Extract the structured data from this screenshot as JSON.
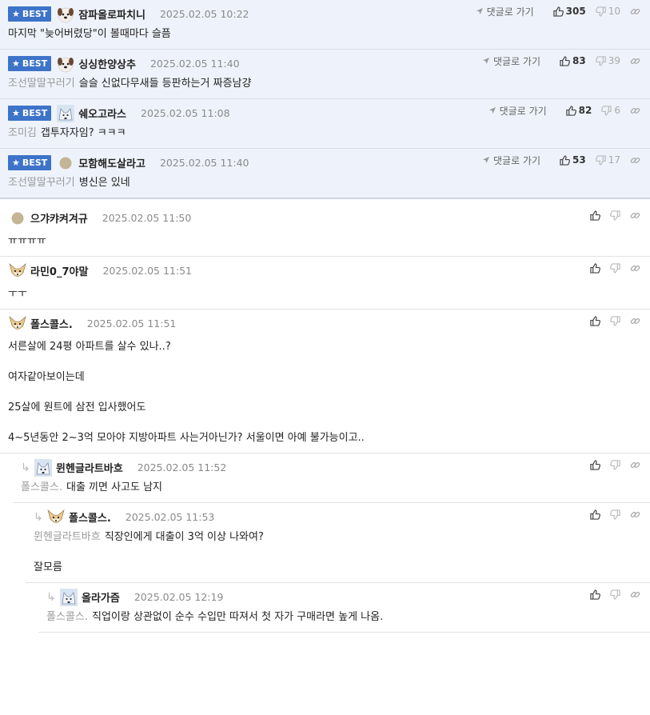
{
  "ui": {
    "best_label": "BEST",
    "goto_label": "댓글로 가기"
  },
  "best_comments": [
    {
      "nick": "잠파올로파치니",
      "avatar": "dog-avatar",
      "date": "2025.02.05 10:22",
      "likes": "305",
      "dislikes": "10",
      "mention": "",
      "lines": [
        "마지막 \"늦어버렸당\"이 볼때마다 슬픔"
      ]
    },
    {
      "nick": "싱싱한양상추",
      "avatar": "dog-avatar",
      "date": "2025.02.05 11:40",
      "likes": "83",
      "dislikes": "39",
      "mention": "조선딸딸꾸러기",
      "lines": [
        "슬슬 신없다무새들 등판하는거 짜증남걍"
      ]
    },
    {
      "nick": "쉐오고라스",
      "avatar": "wolf-avatar",
      "date": "2025.02.05 11:08",
      "likes": "82",
      "dislikes": "6",
      "mention": "조미김",
      "lines": [
        "갭투자자임? ㅋㅋㅋ"
      ]
    },
    {
      "nick": "모함해도살라고",
      "avatar": "dot-avatar",
      "date": "2025.02.05 11:40",
      "likes": "53",
      "dislikes": "17",
      "mention": "조선딸딸꾸러기",
      "lines": [
        "병신은 있네"
      ]
    }
  ],
  "comments": [
    {
      "nick": "으갸캬켜겨규",
      "avatar": "dot-avatar",
      "date": "2025.02.05 11:50",
      "mention": "",
      "lines": [
        "ㅠㅠㅠㅠ"
      ]
    },
    {
      "nick": "라민0_7야말",
      "avatar": "fox-avatar",
      "date": "2025.02.05 11:51",
      "mention": "",
      "lines": [
        "ㅜㅜ"
      ]
    },
    {
      "nick": "폴스콜스.",
      "avatar": "fox-avatar",
      "date": "2025.02.05 11:51",
      "mention": "",
      "lines": [
        "서른살에 24평 아파트를 살수 있나..?",
        "여자같아보이는데",
        "25살에 원트에 삼전 입사했어도",
        "4~5년동안 2~3억 모아야 지방아파트 사는거아닌가? 서울이면 아예 불가능이고.."
      ]
    },
    {
      "nick": "뮌헨글라트바흐",
      "avatar": "wolf-avatar",
      "date": "2025.02.05 11:52",
      "mention": "폴스콜스.",
      "lines": [
        "대출 끼면 사고도 남지"
      ]
    },
    {
      "nick": "폴스콜스.",
      "avatar": "fox-avatar",
      "date": "2025.02.05 11:53",
      "mention": "뮌헨글라트바흐",
      "lines": [
        "직장인에게 대출이 3억 이상 나와여?",
        "잘모름"
      ]
    },
    {
      "nick": "올라가즘",
      "avatar": "wolf-avatar",
      "date": "2025.02.05 12:19",
      "mention": "폴스콜스.",
      "lines": [
        "직업이랑 상관없이 순수 수입만 따져서 첫 자가 구매라면 높게 나옴."
      ]
    }
  ]
}
